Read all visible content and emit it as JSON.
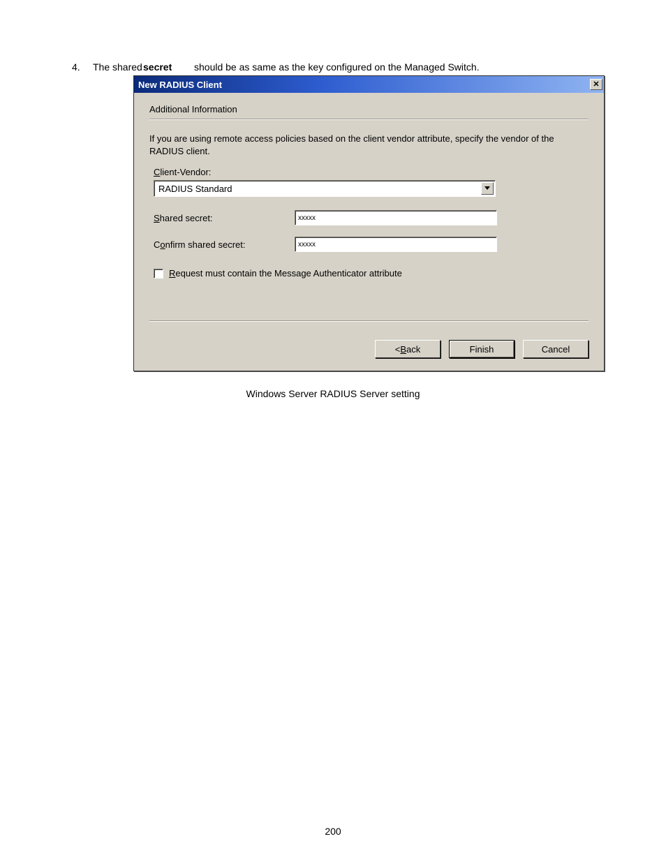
{
  "doc": {
    "list_number": "4.",
    "instruction_prefix": "The shared",
    "instruction_secret": "secret",
    "instruction_suffix": "should be as same as the key configured on the Managed Switch.",
    "figure_caption": "Windows Server RADIUS Server setting",
    "page_number": "200"
  },
  "dialog": {
    "title": "New RADIUS Client",
    "section_heading": "Additional Information",
    "description": "If you are using remote access policies based on the client vendor attribute, specify the vendor of the RADIUS client.",
    "client_vendor": {
      "label_pre": "C",
      "label_post": "lient-Vendor:",
      "value": "RADIUS Standard"
    },
    "shared_secret": {
      "label_pre": "S",
      "label_post": "hared secret:",
      "value": "xxxxx"
    },
    "confirm_secret": {
      "label_pre": "o",
      "label_prefix": "C",
      "label_post": "nfirm shared secret:",
      "value": "xxxxx"
    },
    "checkbox": {
      "label_pre": "R",
      "label_post": "equest must contain the Message Authenticator attribute",
      "checked": false
    },
    "buttons": {
      "back_pre": "< ",
      "back_u": "B",
      "back_post": "ack",
      "finish": "Finish",
      "cancel": "Cancel"
    }
  }
}
